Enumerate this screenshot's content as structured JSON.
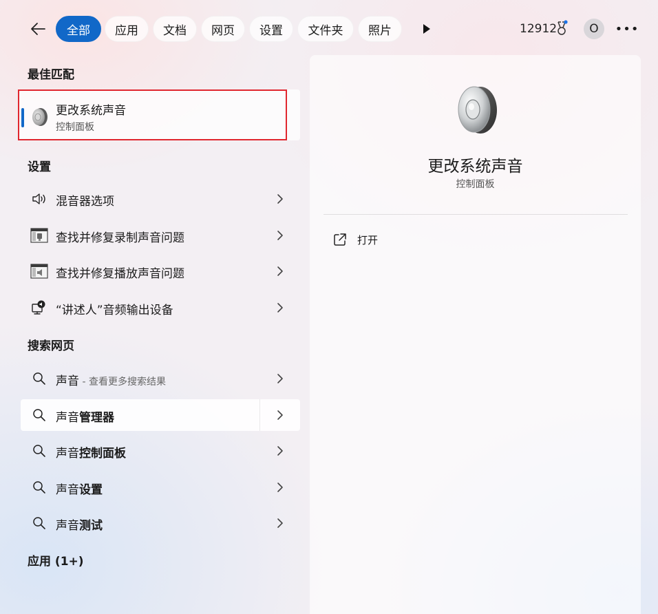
{
  "topbar": {
    "tabs": [
      {
        "label": "全部",
        "active": true
      },
      {
        "label": "应用"
      },
      {
        "label": "文档"
      },
      {
        "label": "网页"
      },
      {
        "label": "设置"
      },
      {
        "label": "文件夹"
      },
      {
        "label": "照片"
      }
    ],
    "points": "12912",
    "avatar_initial": "O",
    "more_label": "•••"
  },
  "sections": {
    "best_match": "最佳匹配",
    "settings": "设置",
    "web": "搜索网页",
    "apps": "应用 (1+)"
  },
  "best_match": {
    "title": "更改系统声音",
    "subtitle": "控制面板",
    "icon": "speaker-icon"
  },
  "settings_items": [
    {
      "label": "混音器选项",
      "icon": "volume-icon"
    },
    {
      "label": "查找并修复录制声音问题",
      "icon": "troubleshoot-recording-icon"
    },
    {
      "label": "查找并修复播放声音问题",
      "icon": "troubleshoot-playback-icon"
    },
    {
      "label": "“讲述人”音频输出设备",
      "icon": "narrator-icon"
    }
  ],
  "web_items": [
    {
      "prefix": "声音",
      "suffix": " - 查看更多搜索结果"
    },
    {
      "prefix": "声音",
      "bold": "管理器"
    },
    {
      "prefix": "声音",
      "bold": "控制面板"
    },
    {
      "prefix": "声音",
      "bold": "设置"
    },
    {
      "prefix": "声音",
      "bold": "测试"
    }
  ],
  "detail": {
    "title": "更改系统声音",
    "subtitle": "控制面板",
    "open_label": "打开"
  },
  "colors": {
    "accent": "#1168c8",
    "highlight_border": "#e0262e"
  }
}
